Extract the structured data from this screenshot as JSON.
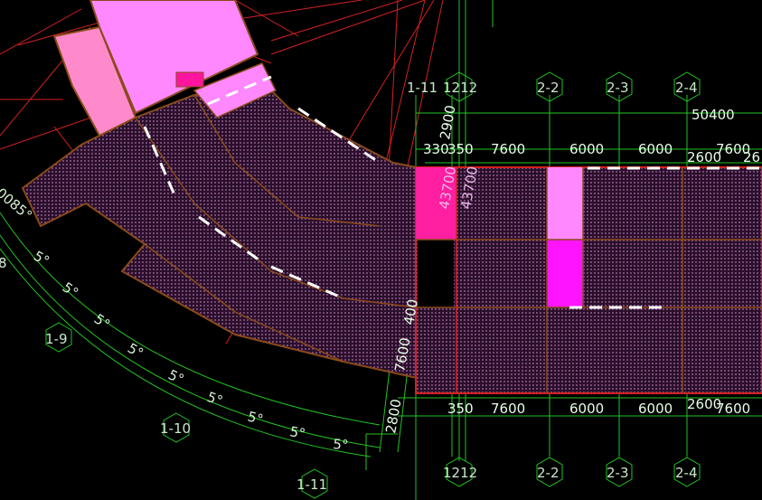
{
  "colors": {
    "background": "#000000",
    "grid": "#22c422",
    "radial": "#d42020",
    "hatch": "#8a4a8a",
    "pink_light": "#ff88ff",
    "pink_salmon": "#ff8acb",
    "magenta": "#ff14ff",
    "hot_pink": "#ff1fa0",
    "outline": "#8a4a1a"
  },
  "grid_labels_top": [
    "1-11",
    "1212",
    "2-2",
    "2-3",
    "2-4"
  ],
  "grid_labels_bottom": [
    "1212",
    "2-2",
    "2-3",
    "2-4"
  ],
  "grid_labels_arc": [
    "1-9",
    "1-10",
    "1-11"
  ],
  "top_dims": {
    "overall": "50400",
    "d1": "330",
    "d2": "350",
    "d3": "7600",
    "d4": "6000",
    "d5": "6000",
    "d6": "7600",
    "d7": "2600",
    "d8": "26"
  },
  "bottom_dims": {
    "d1": "350",
    "d2": "7600",
    "d3": "6000",
    "d4": "6000",
    "d5": "2600",
    "d6": "7600"
  },
  "vertical_dims": {
    "v1": "2900",
    "v2": "43700",
    "v3": "43700",
    "v4": "400",
    "v5": "7600",
    "v6": "2800"
  },
  "angles": [
    "5°",
    "5°",
    "5°",
    "5°",
    "5°",
    "5°",
    "5°",
    "5°"
  ],
  "left_edge": {
    "angle_partial": "0085°",
    "partial": "8"
  }
}
